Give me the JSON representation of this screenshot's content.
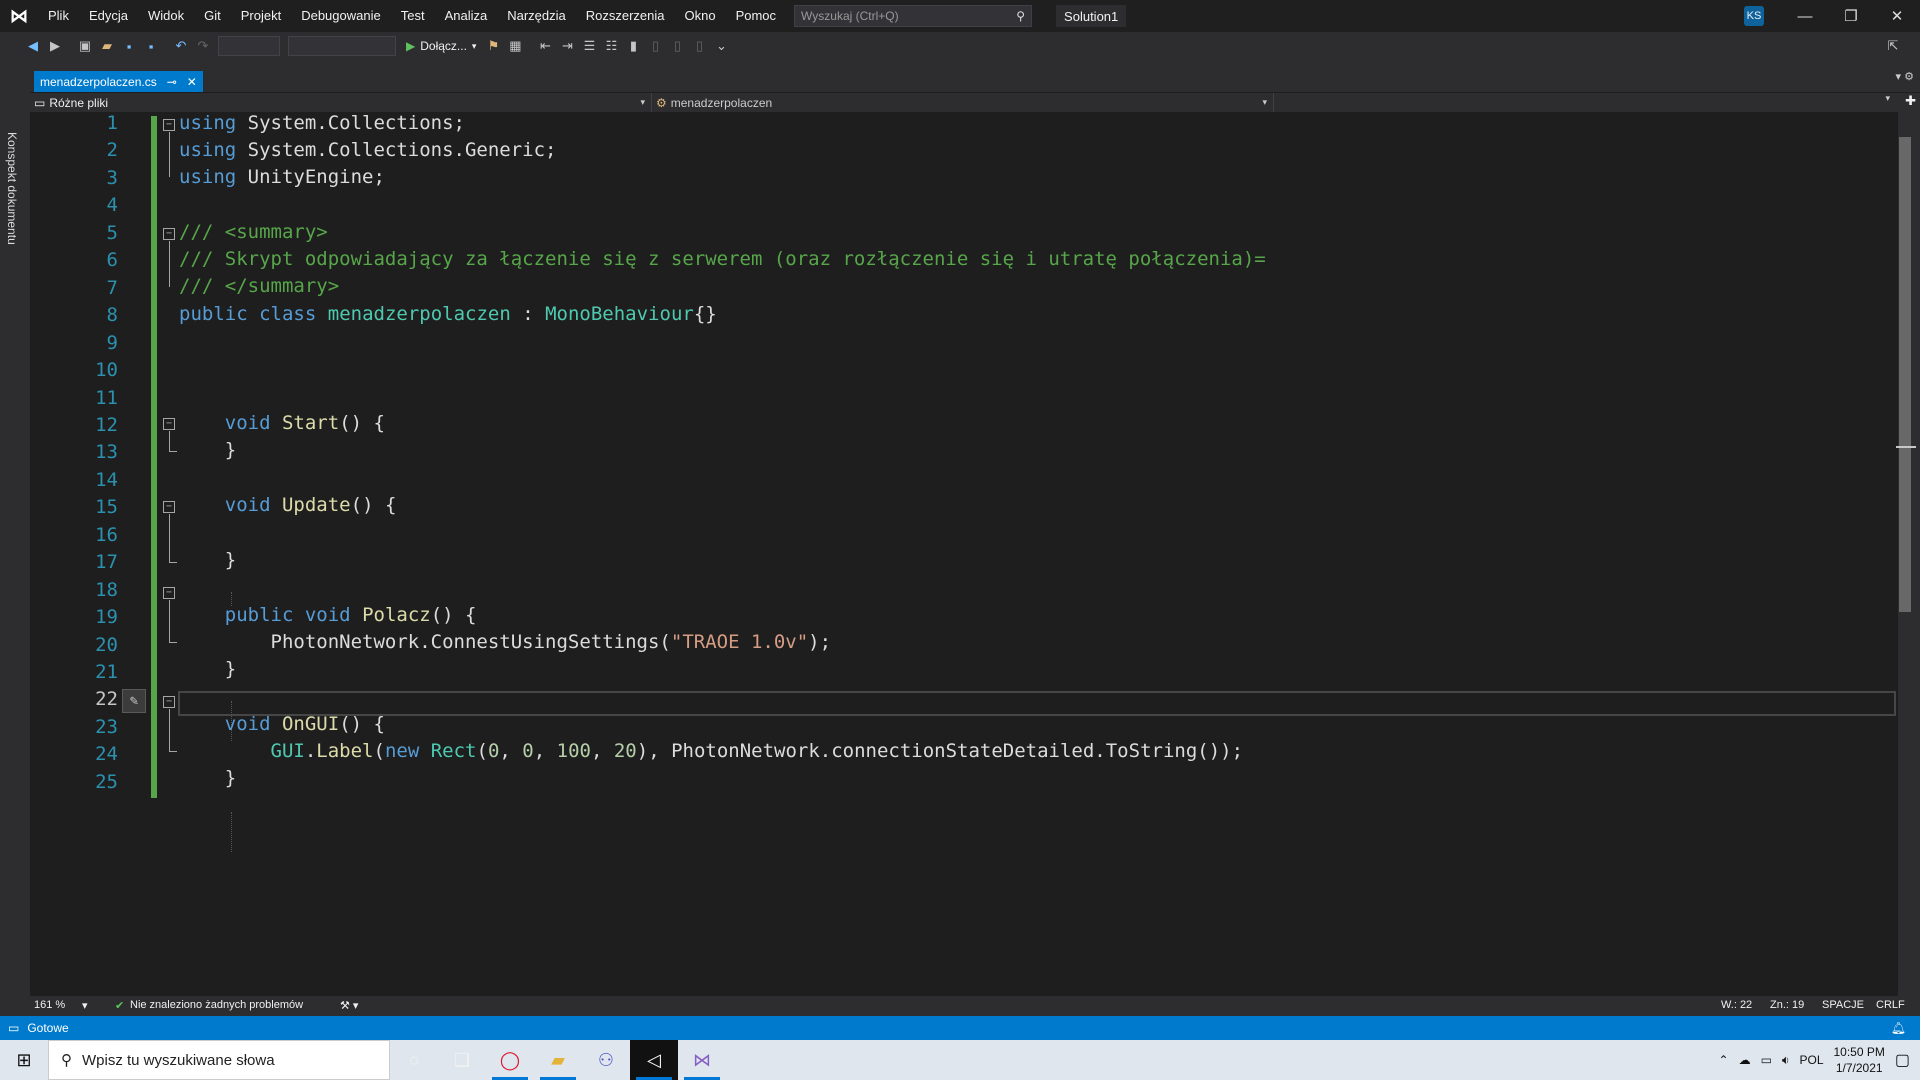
{
  "title_bar": {
    "menu": [
      "Plik",
      "Edycja",
      "Widok",
      "Git",
      "Projekt",
      "Debugowanie",
      "Test",
      "Analiza",
      "Narzędzia",
      "Rozszerzenia",
      "Okno",
      "Pomoc"
    ],
    "search_placeholder": "Wyszukaj (Ctrl+Q)",
    "solution": "Solution1",
    "user_initials": "KS"
  },
  "toolbar": {
    "attach_label": "Dołącz..."
  },
  "left_panel": {
    "label": "Konspekt dokumentu"
  },
  "tab": {
    "filename": "menadzerpolaczen.cs"
  },
  "navbar": {
    "project": "Różne pliki",
    "type": "menadzerpolaczen"
  },
  "editor": {
    "line_numbers": [
      "1",
      "2",
      "3",
      "4",
      "5",
      "6",
      "7",
      "8",
      "9",
      "10",
      "11",
      "12",
      "13",
      "14",
      "15",
      "16",
      "17",
      "18",
      "19",
      "20",
      "21",
      "22",
      "23",
      "24",
      "25"
    ]
  },
  "bottom_bar": {
    "zoom": "161 %",
    "issues": "Nie znaleziono żadnych problemów",
    "line": "W.: 22",
    "col": "Zn.: 19",
    "indent": "SPACJE",
    "eol": "CRLF"
  },
  "status_bar": {
    "text": "Gotowe"
  },
  "taskbar": {
    "search_placeholder": "Wpisz tu wyszukiwane słowa",
    "lang": "POL",
    "time": "10:50 PM",
    "date": "1/7/2021"
  },
  "colors": {
    "accent": "#007acc",
    "keyword": "#569cd6",
    "type": "#4ec9b0",
    "comment": "#57a64a",
    "string": "#d69d85"
  }
}
